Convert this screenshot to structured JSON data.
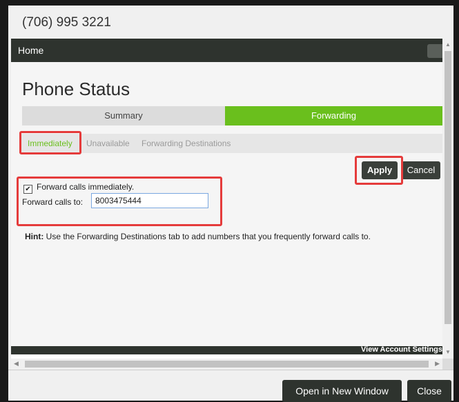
{
  "dialog": {
    "title": "(706) 995 3221"
  },
  "nav": {
    "home": "Home"
  },
  "page": {
    "title": "Phone Status"
  },
  "tabs": [
    {
      "label": "Summary",
      "active": false
    },
    {
      "label": "Forwarding",
      "active": true
    }
  ],
  "subtabs": [
    {
      "label": "Immediately",
      "active": true
    },
    {
      "label": "Unavailable",
      "active": false
    },
    {
      "label": "Forwarding Destinations",
      "active": false
    }
  ],
  "actions": {
    "apply": "Apply",
    "cancel": "Cancel"
  },
  "form": {
    "forward_immediately_label": "Forward calls immediately.",
    "forward_immediately_checked": true,
    "forward_to_label": "Forward calls to:",
    "forward_to_value": "8003475444"
  },
  "hint": {
    "prefix": "Hint:",
    "text": " Use the Forwarding Destinations tab to add numbers that you frequently forward calls to."
  },
  "footer": {
    "account_settings": "View Account Settings"
  },
  "bottom": {
    "open_new_window": "Open in New Window",
    "close": "Close"
  },
  "colors": {
    "accent": "#6abf1d",
    "dark": "#2e332e",
    "highlight": "#e53b3b"
  }
}
